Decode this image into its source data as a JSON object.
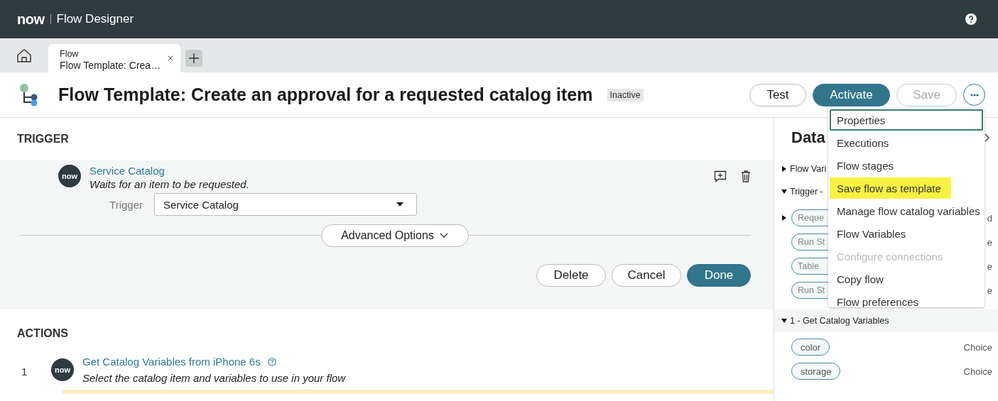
{
  "app": {
    "logo": "now",
    "title": "Flow Designer"
  },
  "tabs": [
    {
      "kind": "home",
      "selected": false
    },
    {
      "kind": "document",
      "label": "Flow",
      "title": "Flow Template: Crea…",
      "selected": true
    }
  ],
  "header": {
    "title": "Flow Template: Create an approval for a requested catalog item",
    "status": "Inactive",
    "buttons": [
      {
        "label": "Test",
        "kind": "outline",
        "disabled": false
      },
      {
        "label": "Activate",
        "kind": "primary",
        "disabled": false
      },
      {
        "label": "Save",
        "kind": "outline",
        "disabled": true
      }
    ]
  },
  "menu": [
    {
      "label": "Properties",
      "selected": true,
      "highlighted": false,
      "disabled": false
    },
    {
      "label": "Executions",
      "selected": false,
      "highlighted": false,
      "disabled": false
    },
    {
      "label": "Flow stages",
      "selected": false,
      "highlighted": false,
      "disabled": false
    },
    {
      "label": "Save flow as template",
      "selected": false,
      "highlighted": true,
      "disabled": false
    },
    {
      "label": "Manage flow catalog variables",
      "selected": false,
      "highlighted": false,
      "disabled": false
    },
    {
      "label": "Flow Variables",
      "selected": false,
      "highlighted": false,
      "disabled": false
    },
    {
      "label": "Configure connections",
      "selected": false,
      "highlighted": false,
      "disabled": true
    },
    {
      "label": "Copy flow",
      "selected": false,
      "highlighted": false,
      "disabled": false
    },
    {
      "label": "Flow preferences",
      "selected": false,
      "highlighted": false,
      "disabled": false
    }
  ],
  "trigger": {
    "heading": "TRIGGER",
    "logo": "now",
    "name": "Service Catalog",
    "description": "Waits for an item to be requested.",
    "field_label": "Trigger",
    "field_value": "Service Catalog",
    "advanced": "Advanced Options",
    "buttons": [
      {
        "label": "Delete",
        "kind": "outline"
      },
      {
        "label": "Cancel",
        "kind": "outline"
      },
      {
        "label": "Done",
        "kind": "primary"
      }
    ]
  },
  "actions": {
    "heading": "ACTIONS",
    "items": [
      {
        "number": "1",
        "logo": "now",
        "name": "Get Catalog Variables from iPhone 6s",
        "description": "Select the catalog item and variables to use in your flow",
        "selected": true
      }
    ]
  },
  "data_panel": {
    "title": "Data",
    "sections": [
      {
        "label": "Flow Vari",
        "expanded": false
      },
      {
        "label": "Trigger -",
        "expanded": true,
        "items": [
          {
            "label": "Reque",
            "type": "d",
            "kind": "object"
          },
          {
            "label": "Run St",
            "type": "e",
            "kind": "field"
          },
          {
            "label": "Table",
            "type": "e",
            "kind": "field"
          },
          {
            "label": "Run St",
            "type": "e",
            "kind": "field"
          }
        ]
      },
      {
        "label": "1 - Get Catalog Variables",
        "expanded": true,
        "items": [
          {
            "label": "color",
            "type": "Choice",
            "kind": "field"
          },
          {
            "label": "storage",
            "type": "Choice",
            "kind": "field"
          }
        ]
      }
    ]
  }
}
